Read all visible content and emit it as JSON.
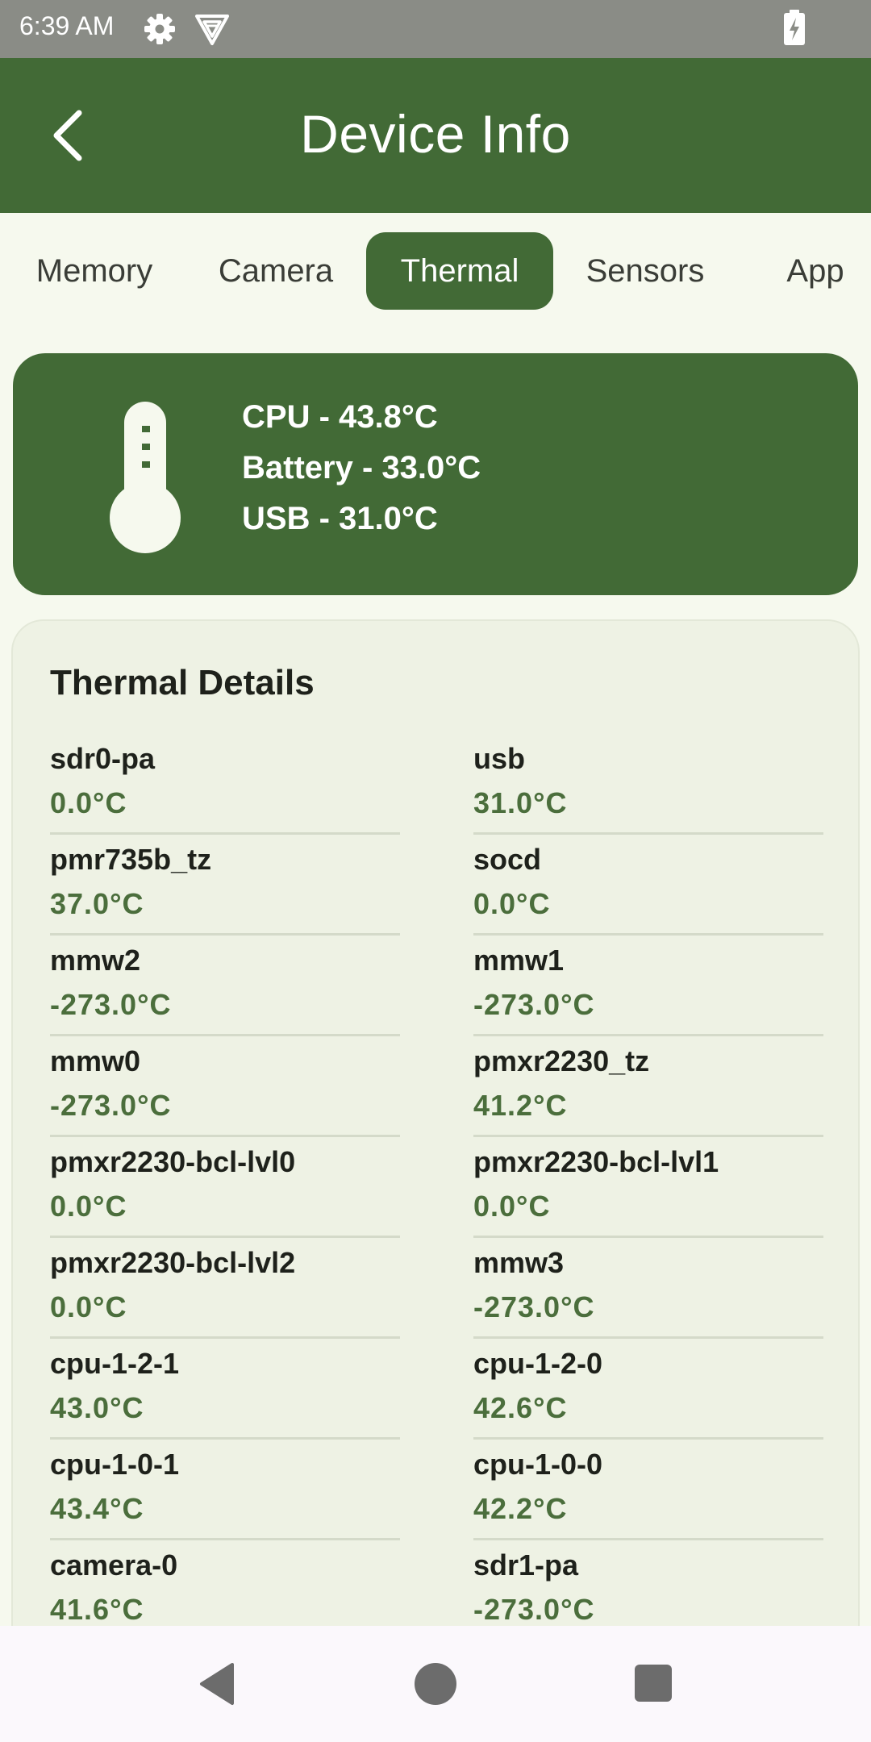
{
  "status_bar": {
    "time": "6:39 AM",
    "icons": [
      "settings-icon",
      "vpn-icon",
      "battery-charging-icon"
    ]
  },
  "app_bar": {
    "title": "Device Info",
    "back_icon": "chevron-left-icon"
  },
  "tabs": [
    {
      "label": "Memory",
      "active": false
    },
    {
      "label": "Camera",
      "active": false
    },
    {
      "label": "Thermal",
      "active": true
    },
    {
      "label": "Sensors",
      "active": false
    },
    {
      "label": "App",
      "active": false
    }
  ],
  "summary": {
    "icon": "thermometer-icon",
    "lines": [
      "CPU - 43.8°C",
      "Battery - 33.0°C",
      "USB - 31.0°C"
    ]
  },
  "details": {
    "title": "Thermal Details",
    "items": [
      {
        "name": "sdr0-pa",
        "value": "0.0°C"
      },
      {
        "name": "usb",
        "value": "31.0°C"
      },
      {
        "name": "pmr735b_tz",
        "value": "37.0°C"
      },
      {
        "name": "socd",
        "value": "0.0°C"
      },
      {
        "name": "mmw2",
        "value": "-273.0°C"
      },
      {
        "name": "mmw1",
        "value": "-273.0°C"
      },
      {
        "name": "mmw0",
        "value": "-273.0°C"
      },
      {
        "name": "pmxr2230_tz",
        "value": "41.2°C"
      },
      {
        "name": "pmxr2230-bcl-lvl0",
        "value": "0.0°C"
      },
      {
        "name": "pmxr2230-bcl-lvl1",
        "value": "0.0°C"
      },
      {
        "name": "pmxr2230-bcl-lvl2",
        "value": "0.0°C"
      },
      {
        "name": "mmw3",
        "value": "-273.0°C"
      },
      {
        "name": "cpu-1-2-1",
        "value": "43.0°C"
      },
      {
        "name": "cpu-1-2-0",
        "value": "42.6°C"
      },
      {
        "name": "cpu-1-0-1",
        "value": "43.4°C"
      },
      {
        "name": "cpu-1-0-0",
        "value": "42.2°C"
      },
      {
        "name": "camera-0",
        "value": "41.6°C"
      },
      {
        "name": "sdr1-pa",
        "value": "-273.0°C"
      }
    ]
  },
  "nav_bar": {
    "icons": [
      "nav-back-icon",
      "nav-home-icon",
      "nav-recents-icon"
    ]
  },
  "colors": {
    "primary": "#426a36",
    "value_text": "#4b6e3c",
    "background": "#f6f9ee",
    "card_background": "#eef2e4"
  }
}
